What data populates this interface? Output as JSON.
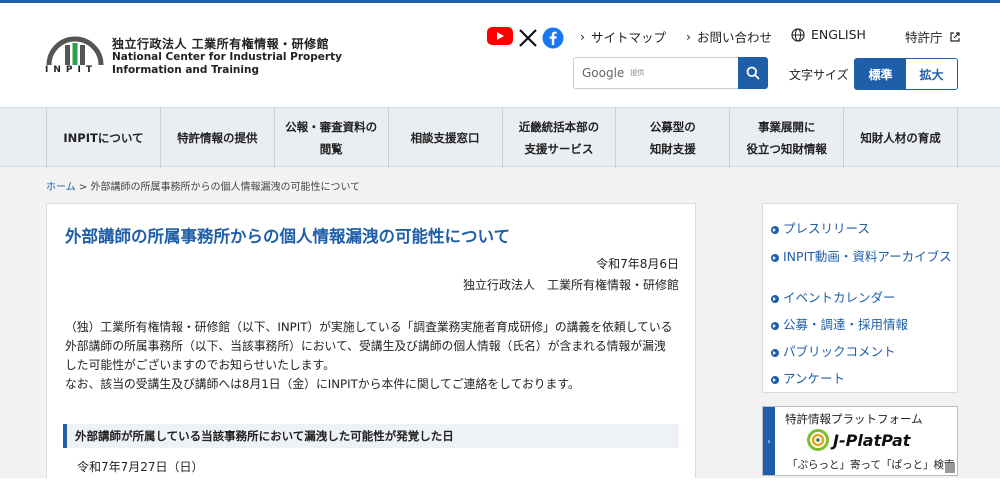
{
  "header": {
    "org_name": "独立行政法人 工業所有権情報・研修館",
    "org_en_line1": "National Center for Industrial Property",
    "org_en_line2": "Information and Training",
    "abbr": "INPIT",
    "links": {
      "sitemap": "サイトマップ",
      "contact": "お問い合わせ",
      "english": "ENGLISH",
      "jpo": "特許庁"
    },
    "search": {
      "brand": "Google",
      "provided": "提供"
    },
    "font_size": {
      "label": "文字サイズ",
      "normal": "標準",
      "large": "拡大"
    }
  },
  "nav": {
    "items": [
      {
        "line1": "INPITについて",
        "line2": ""
      },
      {
        "line1": "特許情報の提供",
        "line2": ""
      },
      {
        "line1": "公報・審査資料の",
        "line2": "閲覧"
      },
      {
        "line1": "相談支援窓口",
        "line2": ""
      },
      {
        "line1": "近畿統括本部の",
        "line2": "支援サービス"
      },
      {
        "line1": "公募型の",
        "line2": "知財支援"
      },
      {
        "line1": "事業展開に",
        "line2": "役立つ知財情報"
      },
      {
        "line1": "知財人材の育成",
        "line2": ""
      }
    ]
  },
  "breadcrumb": {
    "home": "ホーム",
    "sep": " > ",
    "current": "外部講師の所属事務所からの個人情報漏洩の可能性について"
  },
  "article": {
    "title": "外部講師の所属事務所からの個人情報漏洩の可能性について",
    "date": "令和7年8月6日",
    "org": "独立行政法人　工業所有権情報・研修館",
    "para1": "（独）工業所有権情報・研修館（以下、INPIT）が実施している「調査業務実施者育成研修」の講義を依頼している外部講師の所属事務所（以下、当該事務所）において、受講生及び講師の個人情報（氏名）が含まれる情報が漏洩した可能性がございますのでお知らせいたします。",
    "para2": "なお、該当の受講生及び講師へは8月1日（金）にINPITから本件に関してご連絡をしております。",
    "section_title": "外部講師が所属している当該事務所において漏洩した可能性が発覚した日",
    "section_text": "令和7年7月27日（日）"
  },
  "sidebar": {
    "links": [
      "プレスリリース",
      "INPIT動画・資料アーカイブス",
      "イベントカレンダー",
      "公募・調達・採用情報",
      "パブリックコメント",
      "アンケート"
    ]
  },
  "banner": {
    "title": "特許情報プラットフォーム",
    "logo_text": "J-PlatPat",
    "tagline": "「ぷらっと」寄って「ぱっと」検索"
  },
  "colors": {
    "primary": "#1f5ea8",
    "nav_bg": "#eaeef3",
    "page_bg": "#f2f2f2",
    "youtube": "#ff0000",
    "facebook": "#1877f2"
  },
  "icons": [
    "inpit-logo",
    "youtube-icon",
    "x-icon",
    "facebook-icon",
    "chevron-right-icon",
    "globe-icon",
    "external-link-icon",
    "search-icon",
    "bullet-arrow-icon",
    "jplatpat-logo-icon"
  ]
}
